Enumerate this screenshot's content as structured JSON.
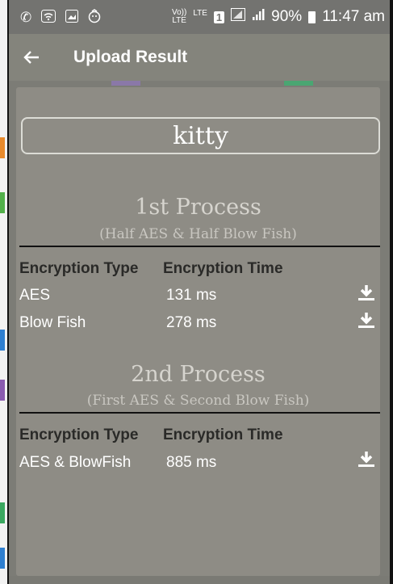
{
  "status_bar": {
    "network_top": "Vo))",
    "network_bottom": "LTE",
    "lte_label": "LTE",
    "sim_slot": "1",
    "battery": "90%",
    "time": "11:47 am"
  },
  "app_bar": {
    "back_icon": "arrow-left-icon",
    "title": "Upload Result"
  },
  "file_name": "kitty",
  "processes": [
    {
      "title": "1st Process",
      "subtitle": "(Half AES & Half Blow Fish)",
      "headers": [
        "Encryption Type",
        "Encryption Time"
      ],
      "rows": [
        {
          "type": "AES",
          "time": "131 ms",
          "icon": "download-icon"
        },
        {
          "type": "Blow Fish",
          "time": "278 ms",
          "icon": "download-icon"
        }
      ]
    },
    {
      "title": "2nd Process",
      "subtitle": "(First AES & Second Blow Fish)",
      "headers": [
        "Encryption Type",
        "Encryption Time"
      ],
      "rows": [
        {
          "type": "AES & BlowFish",
          "time": "885 ms",
          "icon": "download-icon"
        }
      ]
    }
  ],
  "colors": {
    "status_bar": "#737370",
    "app_bar": "#84847c",
    "card": "#8e8c85",
    "background": "#7c7c76"
  }
}
